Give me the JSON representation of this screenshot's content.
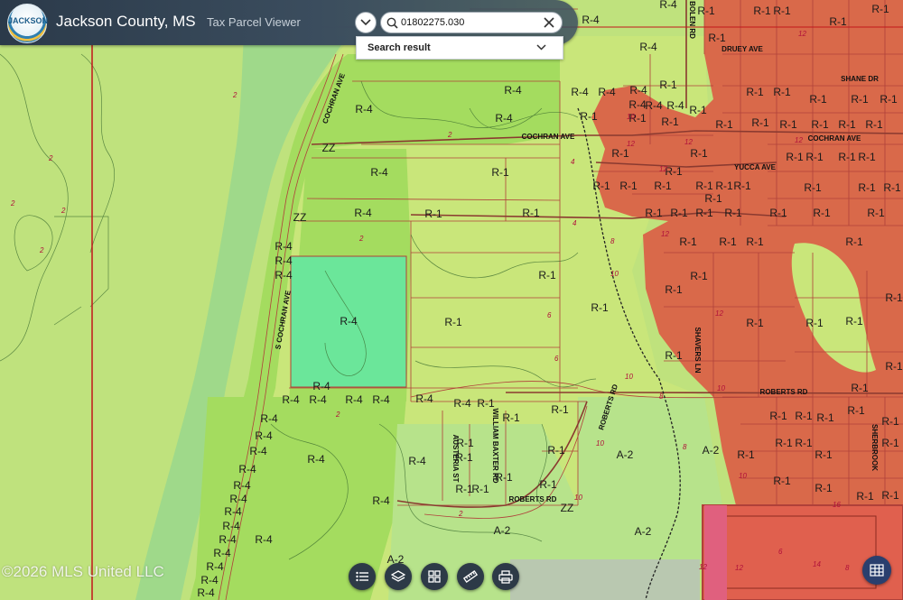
{
  "header": {
    "logo_text": "JACKSON",
    "title": "Jackson County, MS",
    "subtitle": "Tax Parcel Viewer"
  },
  "search": {
    "value": "01802275.030",
    "result_label": "Search result"
  },
  "copyright": "©2026 MLS United LLC",
  "toolbar": {
    "icons": [
      "list-icon",
      "layers-icon",
      "grid-icon",
      "measure-icon",
      "print-icon"
    ],
    "table_icon": "table-icon"
  },
  "map": {
    "colors": {
      "agriculture": "#bfe27d",
      "r4_residential": "#a4dc5f",
      "r1_light": "#c9e67a",
      "r1_dense": "#d9694a",
      "highlight_parcel": "#6be69a",
      "river_band": "#9fd98a",
      "parcel_line": "#b0413a",
      "county_line": "#c2161b"
    },
    "roads": {
      "cochran_ave_north": "COCHRAN AVE",
      "cochran_ave": "COCHRAN AVE",
      "s_cochran_ave": "S COCHRAN AVE",
      "yucca_ave": "YUCCA AVE",
      "druey_ave": "DRUEY AVE",
      "shane_dr": "SHANE DR",
      "bolen_rd": "BOLEN RD",
      "roberts_rd_east": "ROBERTS RD",
      "roberts_rd_diag": "ROBERTS RD",
      "roberts_rd_south": "ROBERTS RD",
      "shavers_ln": "SHAVERS LN",
      "william_baxter_rd": "WILLIAM BAXTER RD",
      "austeria_st": "AUSTERIA ST",
      "sherbrook": "SHERBROOK"
    },
    "zones": {
      "r4": "R-4",
      "r1": "R-1",
      "a2": "A-2",
      "zz": "ZZ"
    },
    "contours": {
      "c2": "2",
      "c4": "4",
      "c6": "6",
      "c8": "8",
      "c10": "10",
      "c12": "12",
      "c14": "14",
      "c16": "16"
    }
  }
}
